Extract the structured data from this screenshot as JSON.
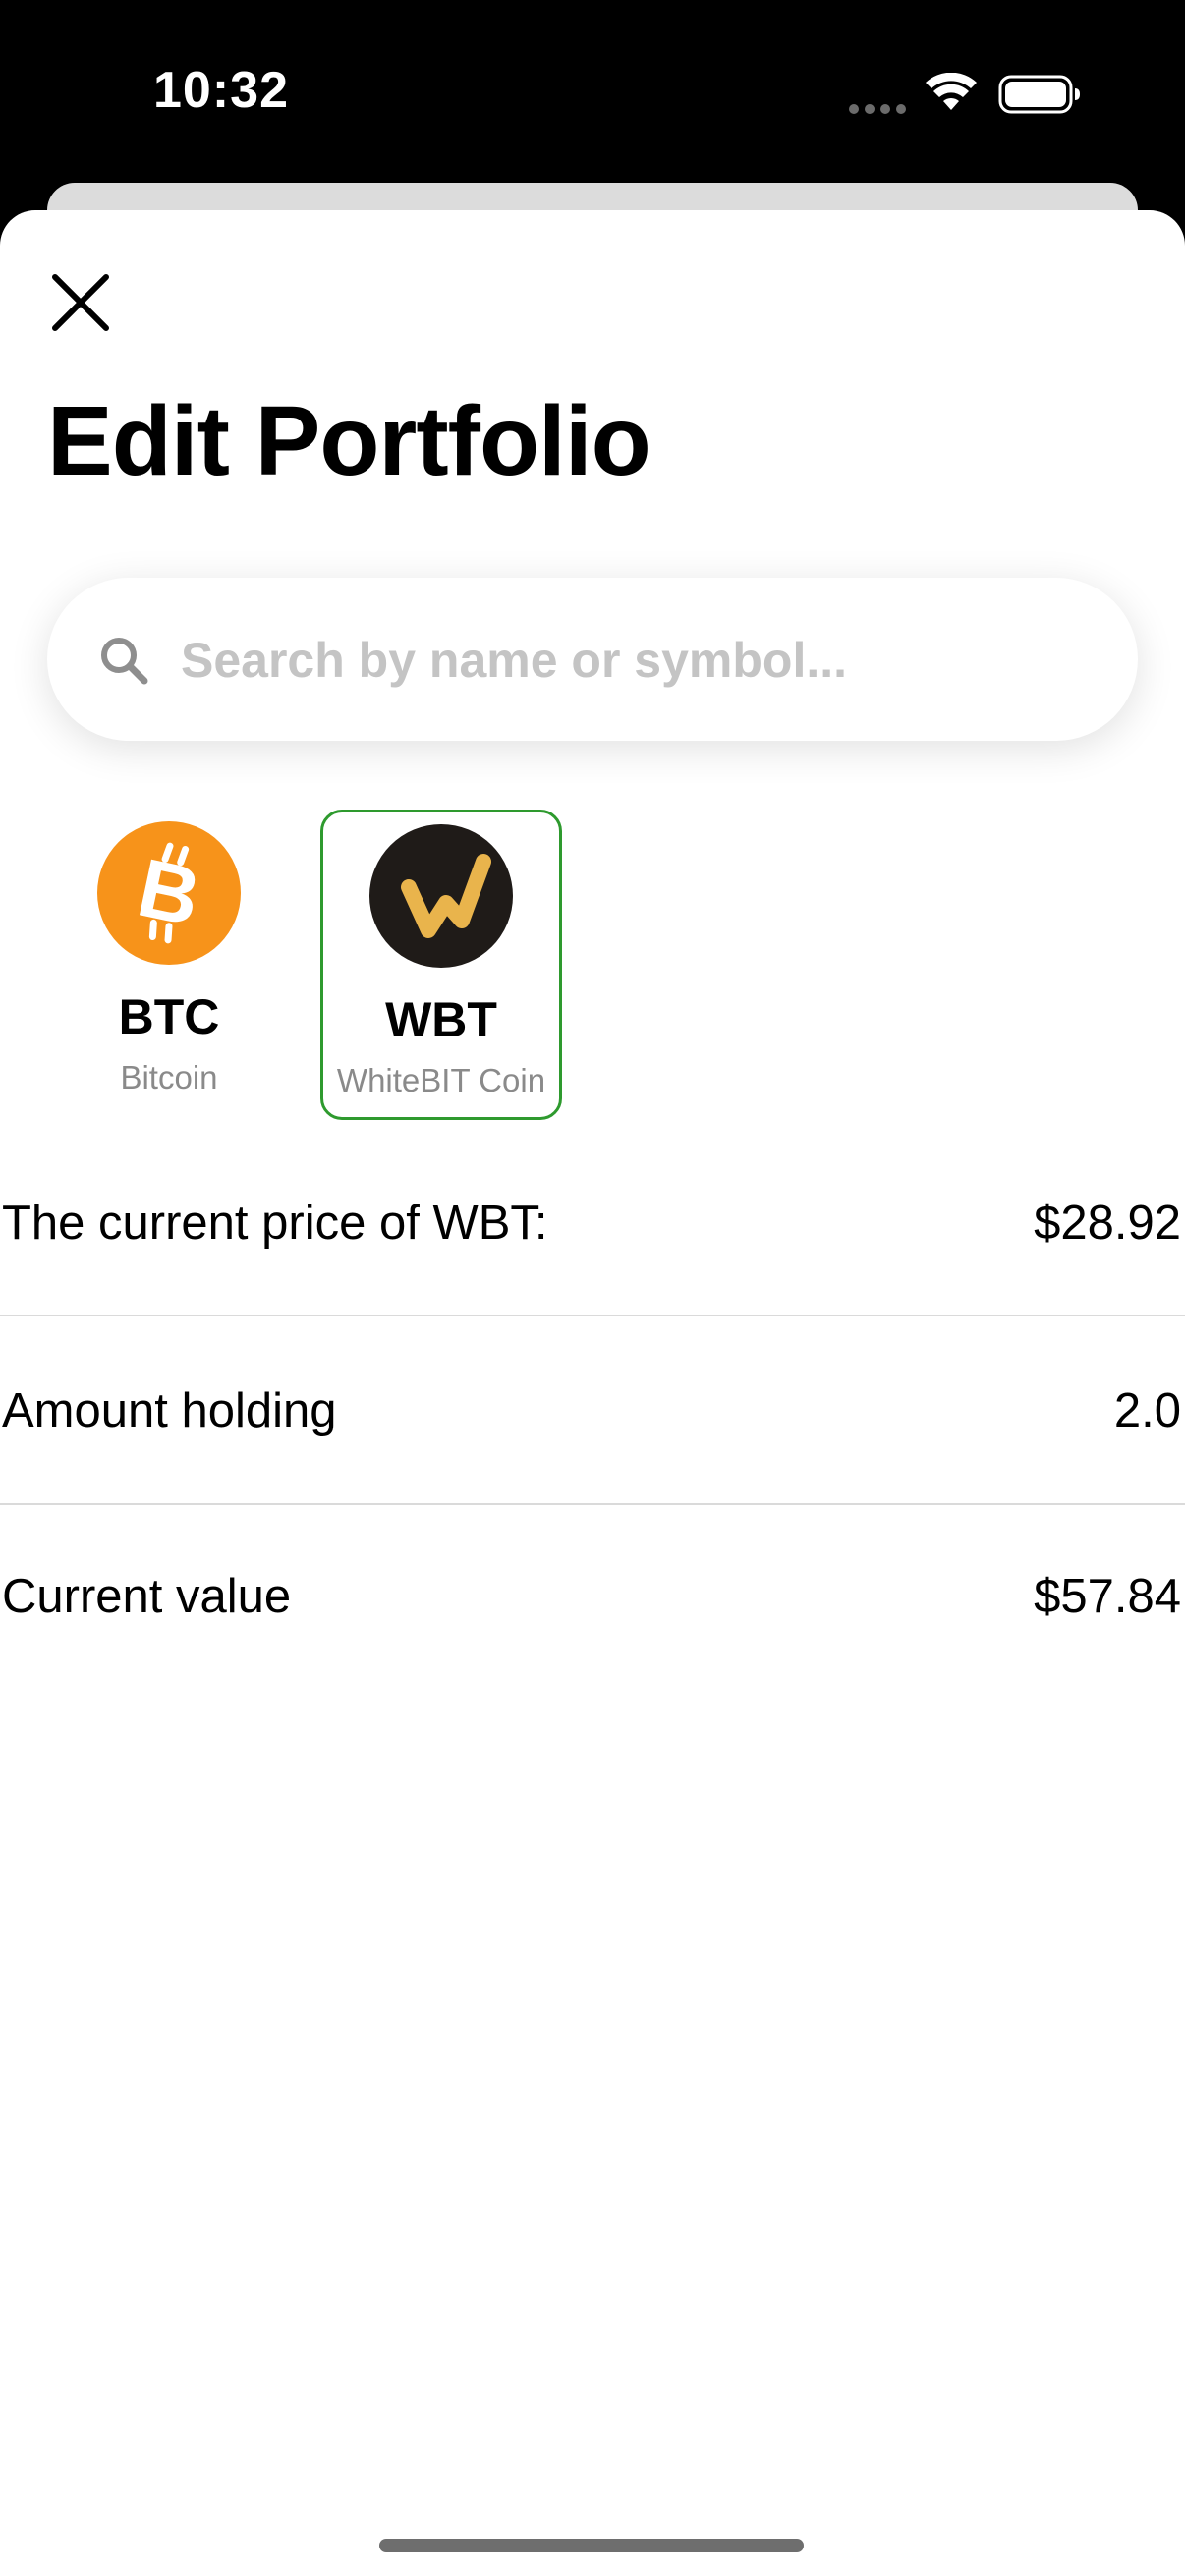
{
  "status_bar": {
    "time": "10:32"
  },
  "header": {
    "title": "Edit Portfolio"
  },
  "search": {
    "placeholder": "Search by name or symbol..."
  },
  "coins": [
    {
      "symbol": "BTC",
      "name": "Bitcoin",
      "icon": "bitcoin-logo",
      "color": "#F7931A",
      "selected": false
    },
    {
      "symbol": "WBT",
      "name": "WhiteBIT Coin",
      "icon": "whitebit-logo",
      "color": "#E9B44C",
      "selected": true
    }
  ],
  "details": {
    "price_label": "The current price of WBT:",
    "price_value": "$28.92",
    "amount_label": "Amount holding",
    "amount_value": "2.0",
    "value_label": "Current value",
    "value_value": "$57.84"
  },
  "colors": {
    "selected_border": "#2E9A2E",
    "placeholder": "#C4C4C4",
    "secondary_text": "#8A8A8A"
  }
}
